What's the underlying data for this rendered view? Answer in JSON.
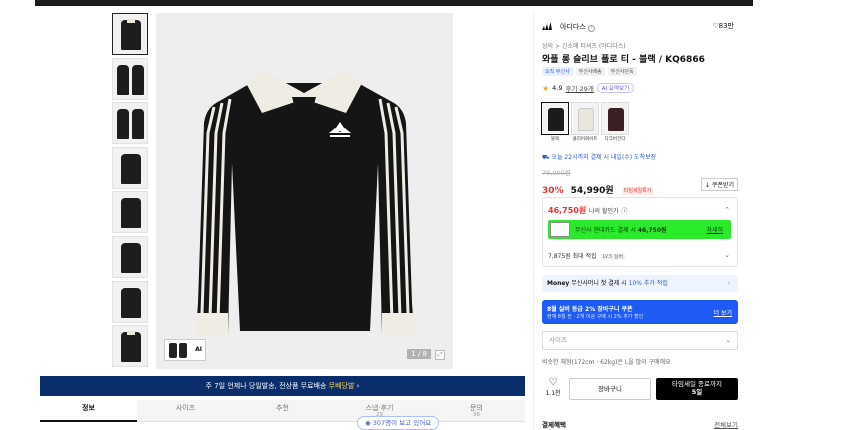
{
  "gallery": {
    "counter": "1 / 8",
    "mini_ai_label": "AI"
  },
  "banner": {
    "prefix": "주 7일 언제나 당일발송, 전상품 무료배송",
    "highlight": "무배당발",
    "arrow": "›"
  },
  "tabs": [
    {
      "label": "정보",
      "count": ""
    },
    {
      "label": "사이즈",
      "count": ""
    },
    {
      "label": "추천",
      "count": ""
    },
    {
      "label": "스냅·후기",
      "count": "29"
    },
    {
      "label": "문의",
      "count": "36"
    }
  ],
  "view_pill": "307명이 보고 있어요",
  "brand": {
    "name": "아디다스",
    "likes": "83만"
  },
  "breadcrumb": "상의 > 긴소매 티셔츠 (아디다스)",
  "product": {
    "title": "와플 롱 슬리브 폴로 티 - 블랙 / KQ6866",
    "badges": [
      "오직 무신사",
      "무신사배송",
      "무신사단독"
    ]
  },
  "rating": {
    "score": "4.9",
    "reviews": "후기 29개",
    "ai_summary": "AI 요약보기"
  },
  "colors": [
    {
      "label": "블랙",
      "hex": "#1b1b1b"
    },
    {
      "label": "클리어화이트",
      "hex": "#e9e6dc"
    },
    {
      "label": "다크버건디",
      "hex": "#3a1f24"
    }
  ],
  "delivery": "오늘 22시까지 결제 시 내일(수) 도착보장",
  "price": {
    "original": "79,000원",
    "discount": "30%",
    "sale": "54,990원",
    "tag": "타임세일특가",
    "coupon": "↓ 쿠폰받기"
  },
  "benefit": {
    "best_price": "46,750원",
    "best_label": "나의 할인가",
    "card_text_prefix": "무신사 현대카드 결제 시",
    "card_price": "46,750원",
    "card_link": "자세히",
    "points": "7,875원 최대 적립",
    "level": "LV.5 실버"
  },
  "money": {
    "brand": "Money",
    "text": "무신사머니 첫 결제 시",
    "highlight": "10% 추가 적립"
  },
  "promo": {
    "title": "8월 실버 등급 2% 장바구니 쿠폰",
    "subtitle": "현재 8월 전 · 2개 이상 구매 시 2% 추가 할인",
    "more": "더 보기"
  },
  "size": {
    "placeholder": "사이즈",
    "note": "비슷한 체형(172cm · 62kg)은 L을 많이 구매해요"
  },
  "actions": {
    "like_count": "1.1천",
    "cart": "장바구니",
    "buy_line1": "타임세일 종료까지",
    "buy_line2": "5일"
  },
  "payment": {
    "label": "결제혜택",
    "link": "전체보기"
  }
}
